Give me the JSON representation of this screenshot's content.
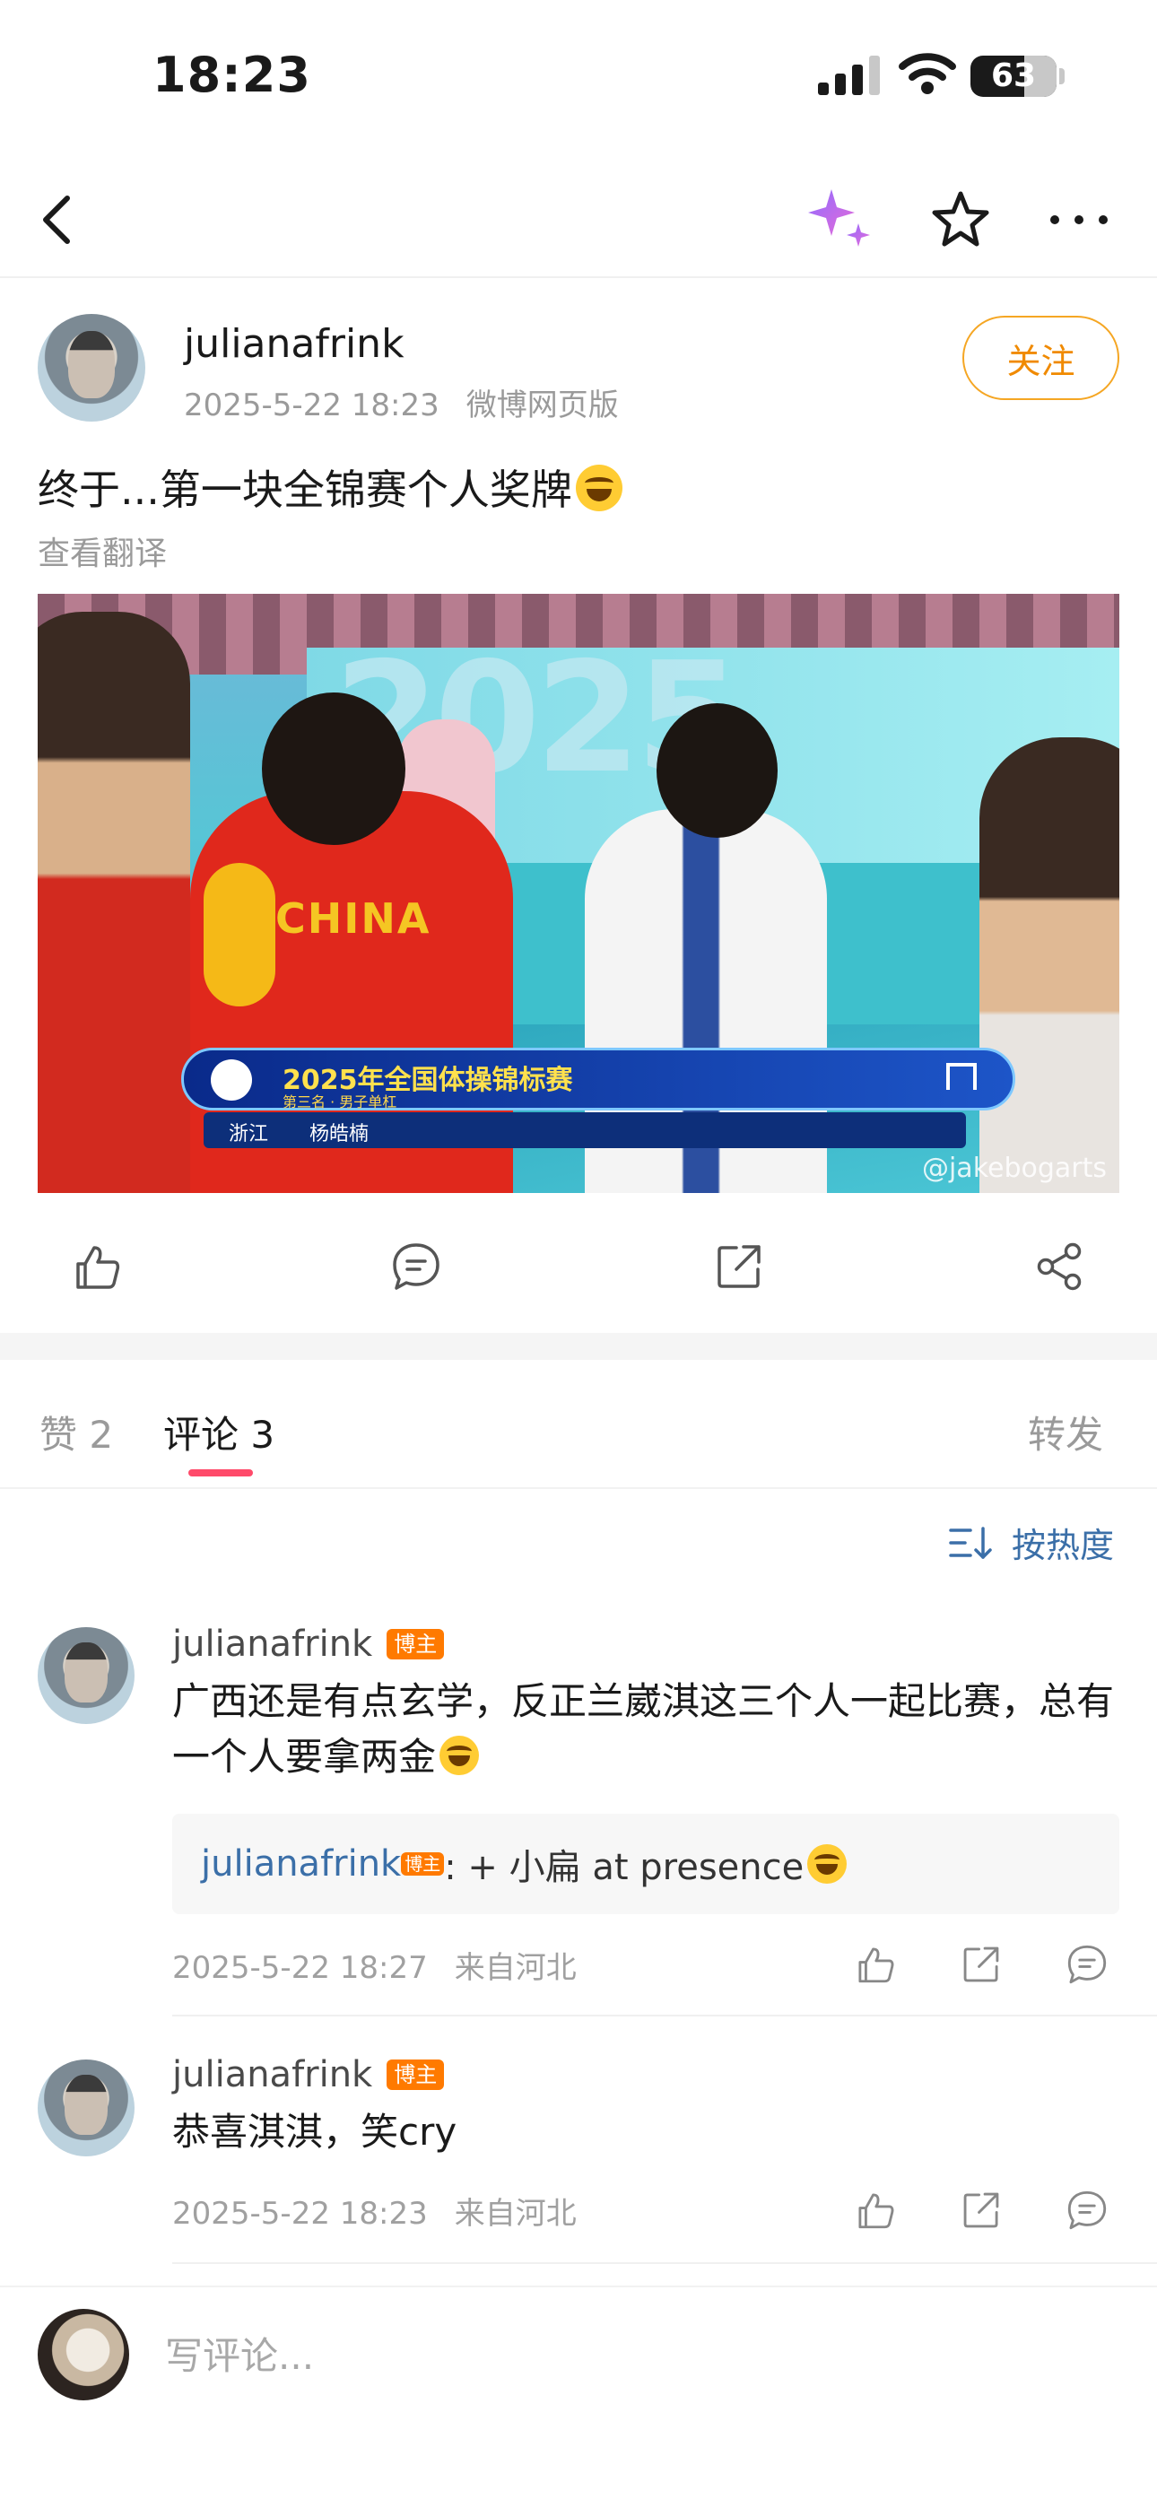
{
  "status_bar": {
    "time": "18:23",
    "battery": "63",
    "battery_level": 0.63
  },
  "post": {
    "author": "julianafrink",
    "date": "2025-5-22 18:23",
    "source": "微博网页版",
    "follow_label": "关注",
    "text": "终于...第一块全锦赛个人奖牌",
    "translate_label": "查看翻译",
    "media": {
      "bg_text": "2025",
      "jersey_text": "CHINA",
      "banner_title": "2025年全国体操锦标赛",
      "banner_subtitle": "第三名 · 男子单杠",
      "banner_team": "浙江",
      "banner_name": "杨皓楠",
      "watermark": "@jakebogarts"
    }
  },
  "tabs": [
    {
      "label": "赞 2"
    },
    {
      "label": "评论 3"
    },
    {
      "label": "转发"
    }
  ],
  "sort_label": "按热度",
  "comments": [
    {
      "author": "julianafrink",
      "badge": "博主",
      "text": "广西还是有点玄学，反正兰崴淇这三个人一起比赛，总有一个人要拿两金",
      "reply_author": "julianafrink",
      "reply_badge": "博主",
      "reply_text": ": + 小扁 at presence",
      "date": "2025-5-22 18:27",
      "location": "来自河北"
    },
    {
      "author": "julianafrink",
      "badge": "博主",
      "text": "恭喜淇淇，笑cry",
      "date": "2025-5-22 18:23",
      "location": "来自河北"
    }
  ],
  "input": {
    "placeholder": "写评论..."
  },
  "colors": {
    "accent": "#ff4a6a",
    "follow": "#f08a00",
    "link": "#3b6fa8",
    "badge": "#ff7a00"
  }
}
